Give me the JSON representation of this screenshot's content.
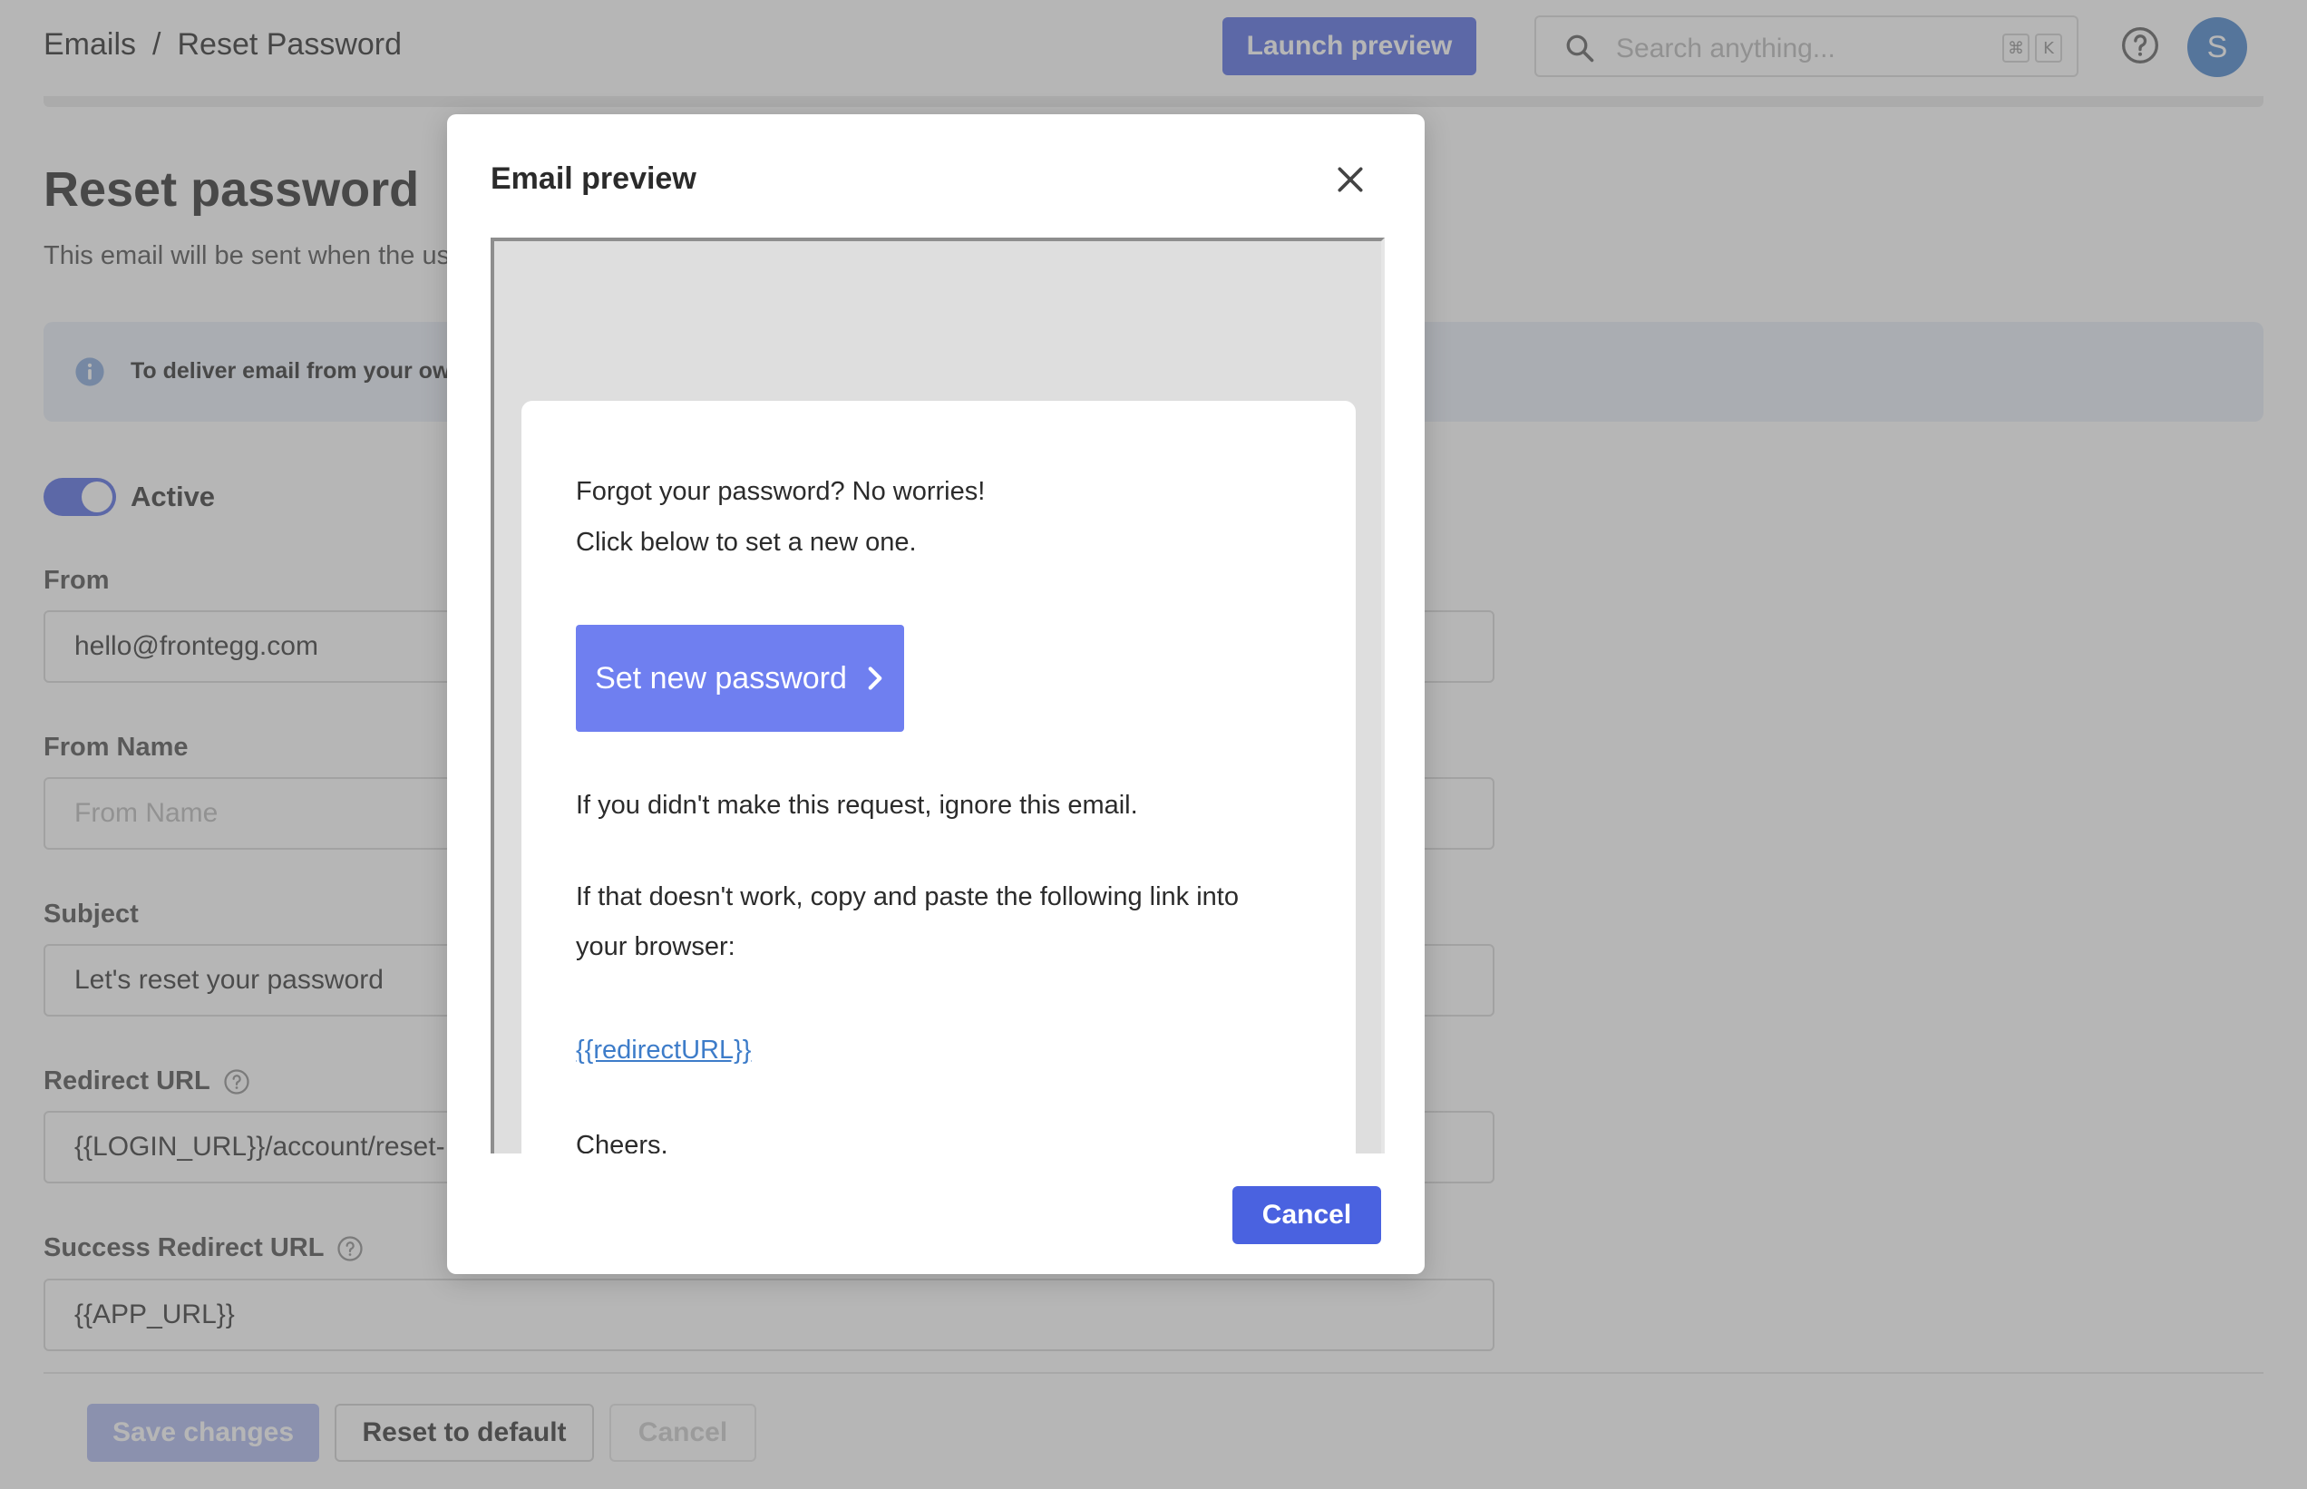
{
  "header": {
    "breadcrumb_parent": "Emails",
    "breadcrumb_separator": "/",
    "breadcrumb_current": "Reset Password",
    "launch_preview_label": "Launch preview",
    "search_placeholder": "Search anything...",
    "shortcut_key_1": "⌘",
    "shortcut_key_2": "K",
    "avatar_initial": "S"
  },
  "page": {
    "title": "Reset password",
    "description": "This email will be sent when the us",
    "info_banner": "To deliver email from your own",
    "active_label": "Active",
    "active": true
  },
  "form": {
    "from_label": "From",
    "from_value": "hello@frontegg.com",
    "from_name_label": "From Name",
    "from_name_placeholder": "From Name",
    "subject_label": "Subject",
    "subject_value": "Let's reset your password",
    "redirect_url_label": "Redirect URL",
    "redirect_url_value": "{{LOGIN_URL}}/account/reset-",
    "success_redirect_url_label": "Success Redirect URL",
    "success_redirect_url_value": "{{APP_URL}}"
  },
  "footer": {
    "save_label": "Save changes",
    "reset_label": "Reset to default",
    "cancel_label": "Cancel"
  },
  "modal": {
    "title": "Email preview",
    "cancel_label": "Cancel",
    "email": {
      "line1": "Forgot your password? No worries!",
      "line2": "Click below to set a new one.",
      "cta_label": "Set new password",
      "ignore_text": "If you didn't make this request, ignore this email.",
      "copy_text_1": "If that doesn't work, copy and paste the following link into",
      "copy_text_2": "your browser:",
      "link_text": "{{redirectURL}}",
      "signoff": "Cheers,"
    }
  },
  "colors": {
    "primary": "#4a62e0",
    "cta": "#6f7ff0",
    "link": "#3d7cc9",
    "avatar": "#3d7cc9"
  }
}
